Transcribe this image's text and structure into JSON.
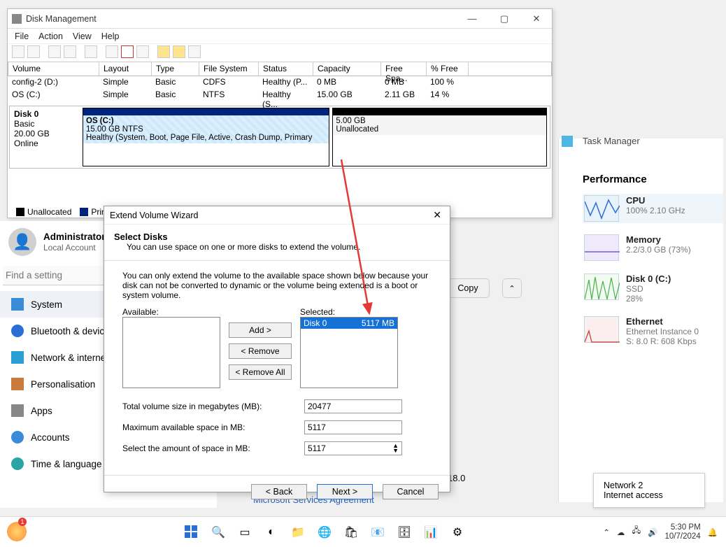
{
  "dm": {
    "title": "Disk Management",
    "menu": {
      "file": "File",
      "action": "Action",
      "view": "View",
      "help": "Help"
    },
    "cols": {
      "volume": "Volume",
      "layout": "Layout",
      "type": "Type",
      "fs": "File System",
      "status": "Status",
      "cap": "Capacity",
      "free": "Free Spa...",
      "pct": "% Free"
    },
    "rows": [
      {
        "volume": "config-2 (D:)",
        "layout": "Simple",
        "type": "Basic",
        "fs": "CDFS",
        "status": "Healthy (P...",
        "cap": "0 MB",
        "free": "0 MB",
        "pct": "100 %"
      },
      {
        "volume": "OS (C:)",
        "layout": "Simple",
        "type": "Basic",
        "fs": "NTFS",
        "status": "Healthy (S...",
        "cap": "15.00 GB",
        "free": "2.11 GB",
        "pct": "14 %"
      }
    ],
    "disk": {
      "name": "Disk 0",
      "type": "Basic",
      "size": "20.00 GB",
      "state": "Online"
    },
    "part_os_name": "OS  (C:)",
    "part_os_size": "15.00 GB NTFS",
    "part_os_status": "Healthy (System, Boot, Page File, Active, Crash Dump, Primary",
    "part_un_size": "5.00 GB",
    "part_un_label": "Unallocated",
    "legend_un": "Unallocated",
    "legend_pp": "Primary partition"
  },
  "settings": {
    "user_name": "Administrator",
    "user_sub": "Local Account",
    "search_placeholder": "Find a setting",
    "items": [
      "System",
      "Bluetooth & devices",
      "Network & internet",
      "Personalisation",
      "Apps",
      "Accounts",
      "Time & language"
    ],
    "copy": "Copy"
  },
  "evw": {
    "title": "Extend Volume Wizard",
    "h": "Select Disks",
    "sub": "You can use space on one or more disks to extend the volume.",
    "note": "You can only extend the volume to the available space shown below because your disk can not be converted to dynamic or the volume being extended is a boot or system volume.",
    "available": "Available:",
    "selected": "Selected:",
    "sel_disk": "Disk 0",
    "sel_size": "5117 MB",
    "btn_add": "Add >",
    "btn_remove": "< Remove",
    "btn_removeall": "< Remove All",
    "f1": "Total volume size in megabytes (MB):",
    "f1v": "20477",
    "f2": "Maximum available space in MB:",
    "f2v": "5117",
    "f3": "Select the amount of space in MB:",
    "f3v": "5117",
    "back": "< Back",
    "next": "Next >",
    "cancel": "Cancel"
  },
  "tm": {
    "app": "Task Manager",
    "title": "Performance",
    "cpu": {
      "name": "CPU",
      "sub": "100%  2.10 GHz"
    },
    "mem": {
      "name": "Memory",
      "sub": "2.2/3.0 GB (73%)"
    },
    "disk": {
      "name": "Disk 0 (C:)",
      "sub1": "SSD",
      "sub2": "28%"
    },
    "eth": {
      "name": "Ethernet",
      "sub1": "Ethernet Instance 0",
      "sub2": "S: 8.0 R: 608 Kbps"
    }
  },
  "net": {
    "name": "Network 2",
    "state": "Internet access"
  },
  "msa": "Microsoft Services Agreement",
  "dev_num": "18.0",
  "tray": {
    "time": "5:30 PM",
    "date": "10/7/2024"
  }
}
